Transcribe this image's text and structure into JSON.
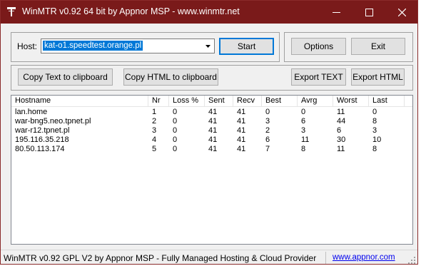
{
  "window": {
    "title": "WinMTR v0.92 64 bit by Appnor MSP - www.winmtr.net",
    "titlebar_color": "#7a1a1a"
  },
  "host": {
    "label": "Host:",
    "value": "kat-o1.speedtest.orange.pl"
  },
  "buttons": {
    "start": "Start",
    "options": "Options",
    "exit": "Exit",
    "copy_text": "Copy Text to clipboard",
    "copy_html": "Copy HTML to clipboard",
    "export_text": "Export TEXT",
    "export_html": "Export HTML"
  },
  "table": {
    "columns": [
      "Hostname",
      "Nr",
      "Loss %",
      "Sent",
      "Recv",
      "Best",
      "Avrg",
      "Worst",
      "Last"
    ],
    "rows": [
      [
        "lan.home",
        "1",
        "0",
        "41",
        "41",
        "0",
        "0",
        "11",
        "0"
      ],
      [
        "war-bng5.neo.tpnet.pl",
        "2",
        "0",
        "41",
        "41",
        "3",
        "6",
        "44",
        "8"
      ],
      [
        "war-r12.tpnet.pl",
        "3",
        "0",
        "41",
        "41",
        "2",
        "3",
        "6",
        "3"
      ],
      [
        "195.116.35.218",
        "4",
        "0",
        "41",
        "41",
        "6",
        "11",
        "30",
        "10"
      ],
      [
        "80.50.113.174",
        "5",
        "0",
        "41",
        "41",
        "7",
        "8",
        "11",
        "8"
      ]
    ]
  },
  "status": {
    "text": "WinMTR v0.92 GPL V2 by Appnor MSP - Fully Managed Hosting & Cloud Provider",
    "link": "www.appnor.com"
  },
  "icons": {
    "app": "winmtr-app-icon",
    "minimize": "minimize-icon",
    "maximize": "maximize-icon",
    "close": "close-icon",
    "dropdown": "chevron-down-icon",
    "resize": "resize-grip-icon"
  }
}
